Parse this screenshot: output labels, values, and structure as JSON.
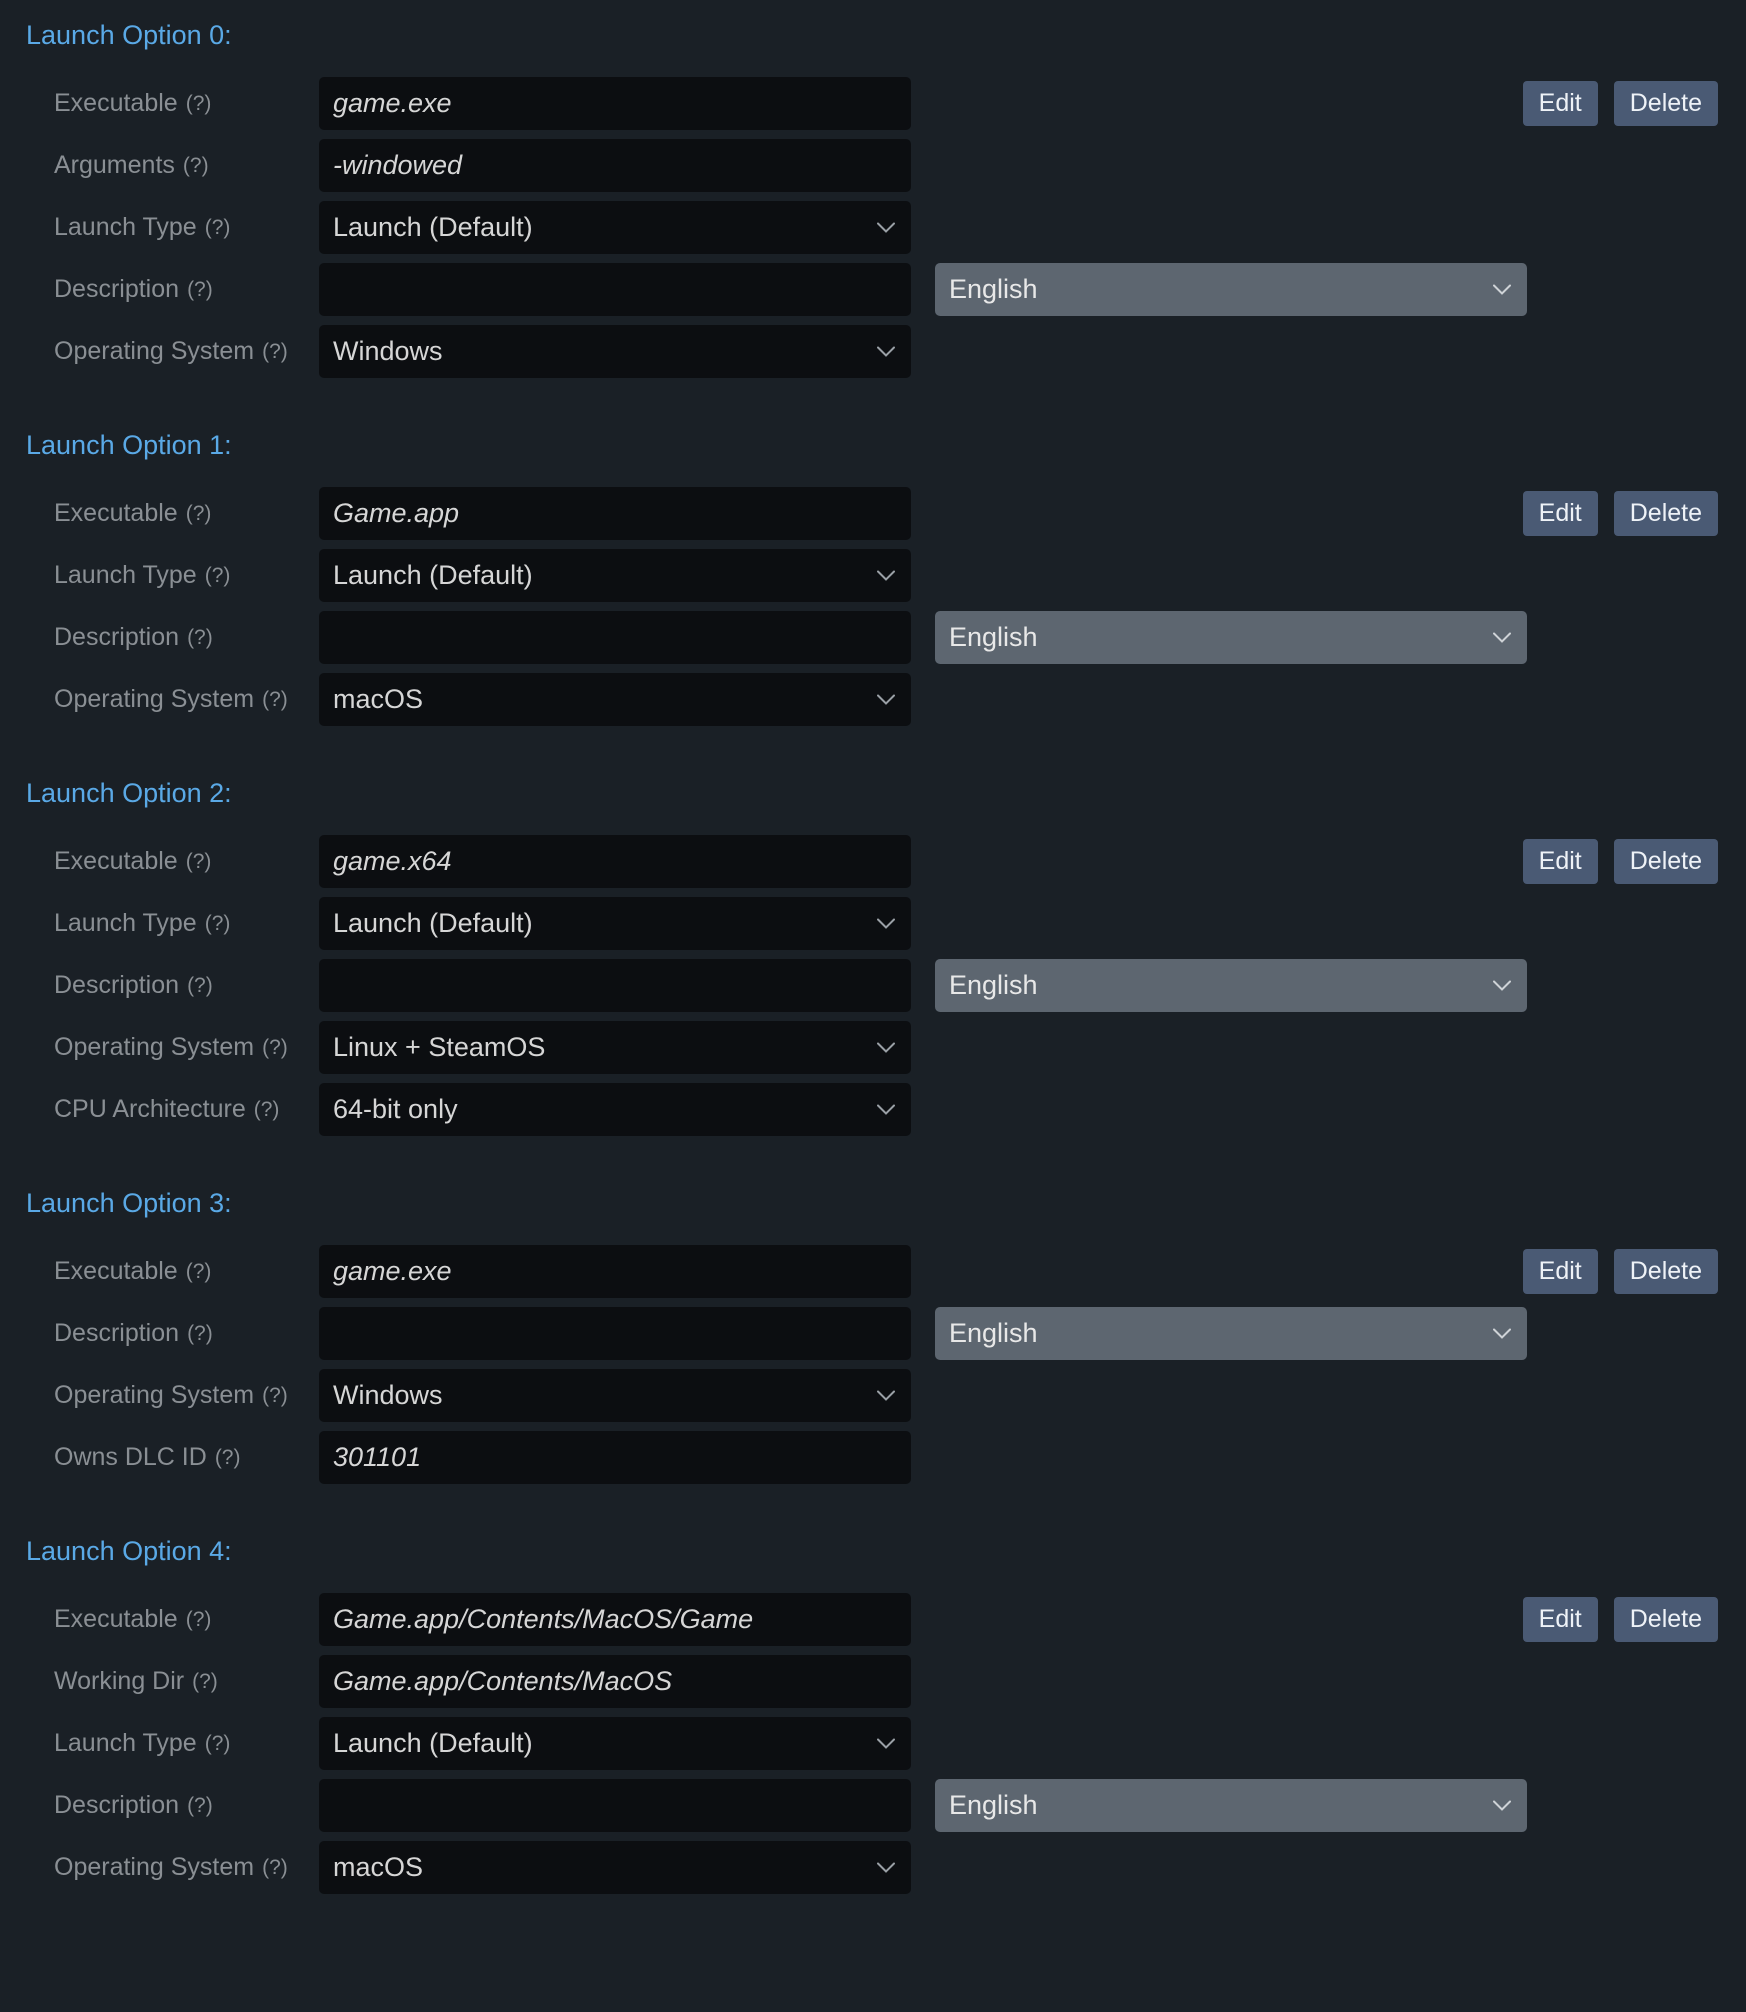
{
  "labels": {
    "executable": "Executable",
    "arguments": "Arguments",
    "launch_type": "Launch Type",
    "description": "Description",
    "operating_system": "Operating System",
    "cpu_architecture": "CPU Architecture",
    "owns_dlc_id": "Owns DLC ID",
    "working_dir": "Working Dir",
    "help": "(?)"
  },
  "buttons": {
    "edit": "Edit",
    "delete": "Delete"
  },
  "common": {
    "launch_default": "Launch (Default)",
    "english": "English"
  },
  "options": [
    {
      "title": "Launch Option 0:",
      "executable": "game.exe",
      "arguments": "-windowed",
      "launch_type": "Launch (Default)",
      "description": "",
      "description_lang": "English",
      "os": "Windows"
    },
    {
      "title": "Launch Option 1:",
      "executable": "Game.app",
      "launch_type": "Launch (Default)",
      "description": "",
      "description_lang": "English",
      "os": "macOS"
    },
    {
      "title": "Launch Option 2:",
      "executable": "game.x64",
      "launch_type": "Launch (Default)",
      "description": "",
      "description_lang": "English",
      "os": "Linux + SteamOS",
      "cpu_arch": "64-bit only"
    },
    {
      "title": "Launch Option 3:",
      "executable": "game.exe",
      "description": "",
      "description_lang": "English",
      "os": "Windows",
      "owns_dlc_id": "301101"
    },
    {
      "title": "Launch Option 4:",
      "executable": "Game.app/Contents/MacOS/Game",
      "working_dir": "Game.app/Contents/MacOS",
      "launch_type": "Launch (Default)",
      "description": "",
      "description_lang": "English",
      "os": "macOS"
    }
  ]
}
